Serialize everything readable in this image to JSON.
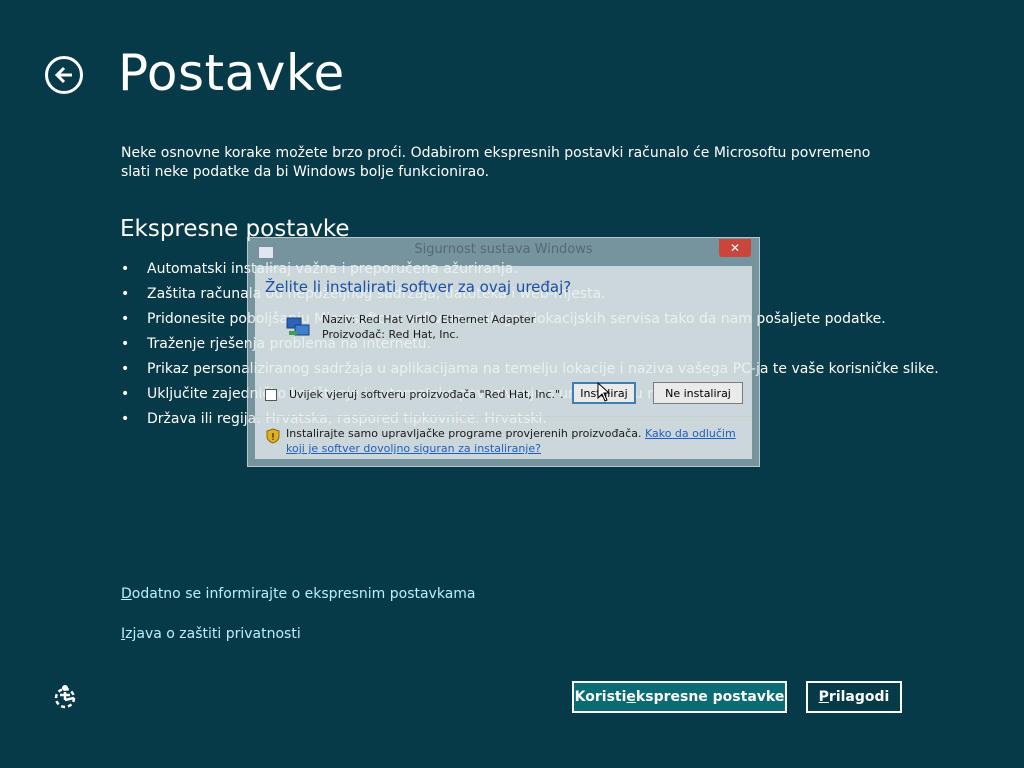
{
  "header": {
    "title": "Postavke"
  },
  "intro": "Neke osnovne korake možete brzo proći. Odabirom ekspresnih postavki računalo će Microsoftu povremeno slati neke podatke da bi Windows bolje funkcionirao.",
  "express": {
    "title": "Ekspresne postavke",
    "bullet_glyph": "•",
    "items": [
      "Automatski instaliraj važna i preporučena ažuriranja.",
      "Zaštita računala od nepoželjnog sadržaja, datoteka i web-mjesta.",
      "Pridonesite poboljšanju Microsoftova softvera, usluga i lokacijskih servisa tako da nam pošaljete podatke.",
      "Traženje rješenja problema na internetu.",
      "Prikaz personaliziranog sadržaja u aplikacijama na temelju lokacije i naziva vašega PC-ja te vaše korisničke slike.",
      "Uključite zajedničko korištenje i automatsko povezivanje s uređajima u mreži.",
      "Država ili regija: Hrvatska; raspored tipkovnice: Hrvatski."
    ]
  },
  "links": {
    "learn_more_first": "D",
    "learn_more_rest": "odatno se informirajte o ekspresnim postavkama",
    "privacy_first": "I",
    "privacy_rest": "zjava o zaštiti privatnosti"
  },
  "buttons": {
    "express_before": "Koristi ",
    "express_u": "e",
    "express_after": "kspresne postavke",
    "customize_u": "P",
    "customize_after": "rilagodi"
  },
  "dialog": {
    "title": "Sigurnost sustava Windows",
    "close_label": "✕",
    "question": "Želite li instalirati softver za ovaj uređaj?",
    "name_line": "Naziv: Red Hat VirtIO Ethernet Adapter",
    "publisher_line": "Proizvođač: Red Hat, Inc.",
    "always_trust": "Uvijek vjeruj softveru proizvođača \"Red Hat, Inc.\".",
    "install_label": "Instaliraj",
    "dont_install_label": "Ne instaliraj",
    "footer_text": "Instalirajte samo upravljačke programe provjerenih proizvođača. ",
    "footer_link": "Kako da odlučim koji je softver dovoljno siguran za instaliranje?"
  },
  "colors": {
    "background": "#073a48",
    "accent_button": "#0b6b74",
    "link": "#b9f0ff"
  }
}
